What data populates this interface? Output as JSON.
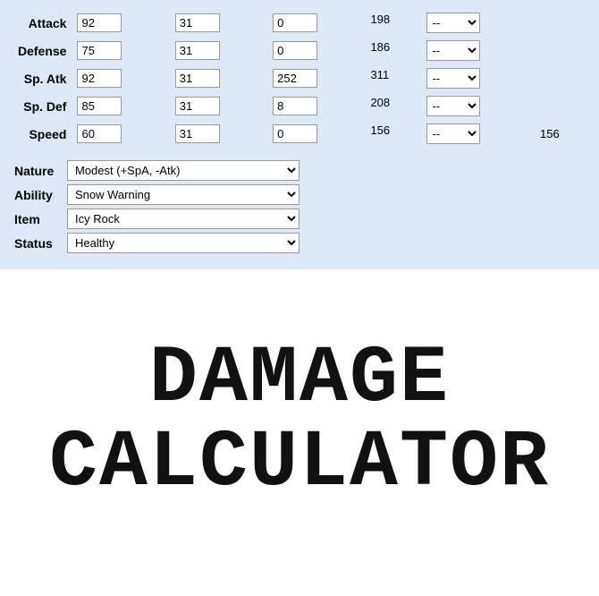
{
  "stats": [
    {
      "label": "Attack",
      "base": "92",
      "iv": "31",
      "ev": "0",
      "total": "198",
      "selectVal": "--"
    },
    {
      "label": "Defense",
      "base": "75",
      "iv": "31",
      "ev": "0",
      "total": "186",
      "selectVal": "--"
    },
    {
      "label": "Sp. Atk",
      "base": "92",
      "iv": "31",
      "ev": "252",
      "total": "311",
      "selectVal": "--"
    },
    {
      "label": "Sp. Def",
      "base": "85",
      "iv": "31",
      "ev": "8",
      "total": "208",
      "selectVal": "--"
    },
    {
      "label": "Speed",
      "base": "60",
      "iv": "31",
      "ev": "0",
      "total": "156",
      "selectVal": "--",
      "extraTotal": "156"
    }
  ],
  "props": [
    {
      "label": "Nature",
      "value": "Modest (+SpA, -Atk)"
    },
    {
      "label": "Ability",
      "value": "Snow Warning"
    },
    {
      "label": "Item",
      "value": "Icy Rock"
    },
    {
      "label": "Status",
      "value": "Healthy"
    }
  ],
  "title_line1": "DAMAGE",
  "title_line2": "CALCULATOR",
  "select_options": [
    "--"
  ],
  "nature_options": [
    "Modest (+SpA, -Atk)"
  ],
  "ability_options": [
    "Snow Warning"
  ],
  "item_options": [
    "Icy Rock"
  ],
  "status_options": [
    "Healthy"
  ]
}
